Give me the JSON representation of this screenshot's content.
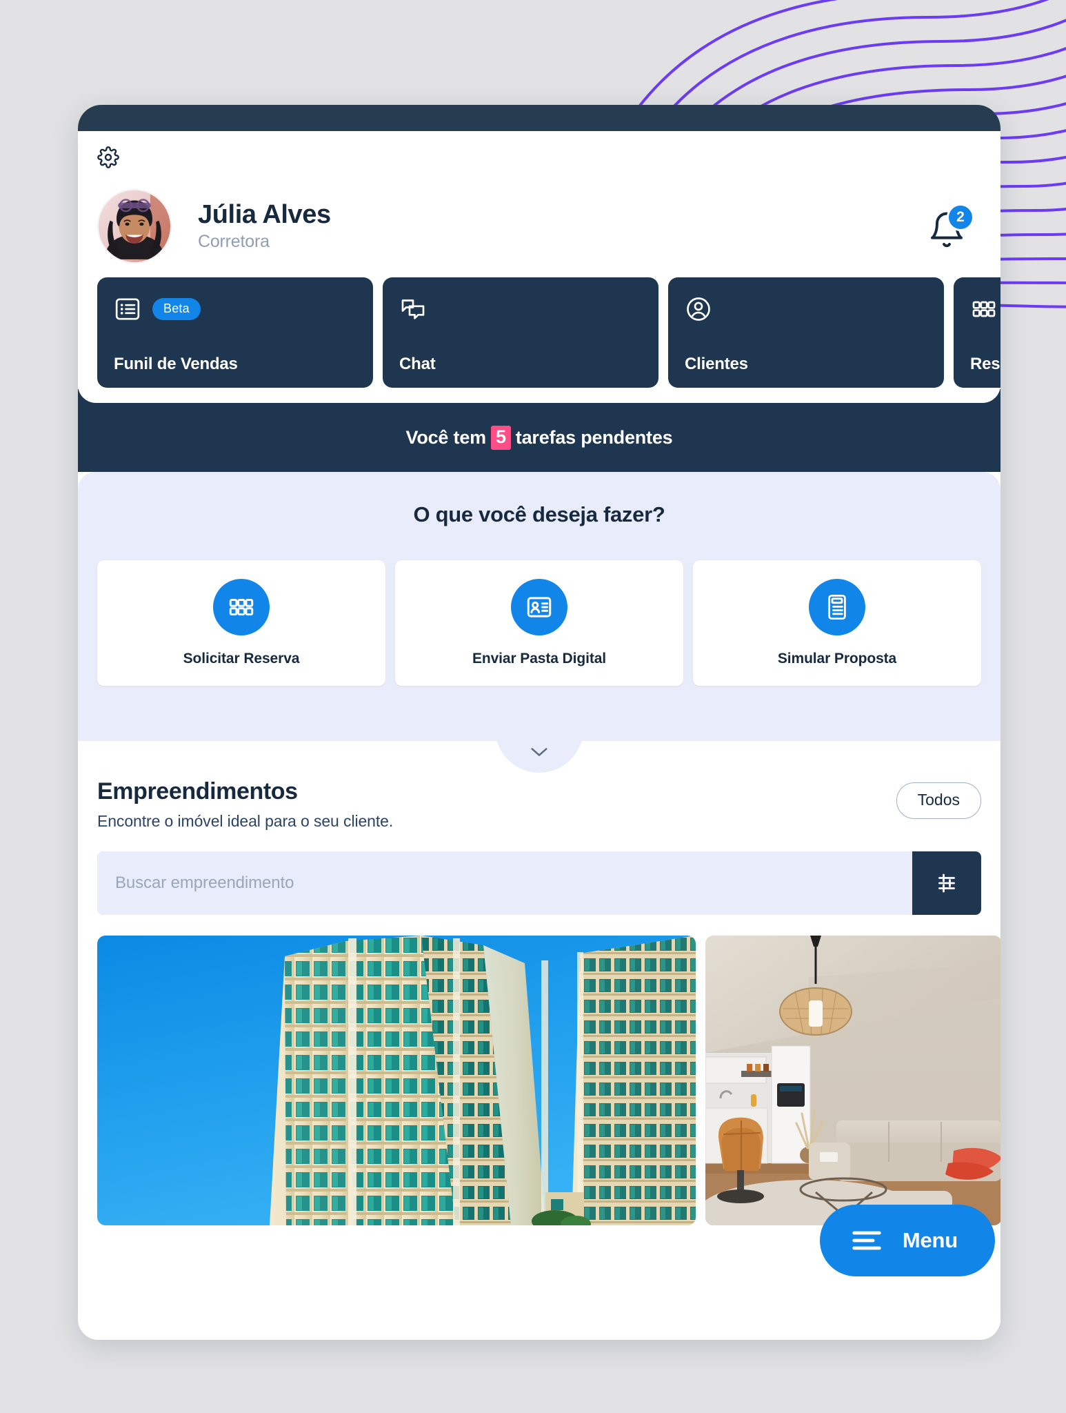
{
  "header": {
    "settings_icon": "gear-icon",
    "profile": {
      "name": "Júlia Alves",
      "role": "Corretora",
      "avatar_icon": "user-photo"
    },
    "notifications": {
      "icon": "bell-icon",
      "count": "2",
      "badge_color": "#1186e8"
    }
  },
  "nav_tiles": [
    {
      "label": "Funil de Vendas",
      "icon": "list-icon",
      "badge": "Beta"
    },
    {
      "label": "Chat",
      "icon": "chat-bubbles-icon",
      "badge": ""
    },
    {
      "label": "Clientes",
      "icon": "user-circle-icon",
      "badge": ""
    },
    {
      "label": "Reserv",
      "icon": "grid-icon",
      "badge": ""
    }
  ],
  "task_banner": {
    "prefix": "Você  tem",
    "count": "5",
    "suffix": "tarefas pendentes",
    "highlight_color": "#ff4d87",
    "background_color": "#1e3650"
  },
  "actions": {
    "title": "O que você deseja fazer?",
    "cards": [
      {
        "label": "Solicitar Reserva",
        "icon": "grid-icon"
      },
      {
        "label": "Enviar Pasta Digital",
        "icon": "id-card-icon"
      },
      {
        "label": "Simular Proposta",
        "icon": "calculator-icon"
      }
    ],
    "collapse_icon": "chevron-down-icon"
  },
  "listings": {
    "title": "Empreendimentos",
    "subtitle": "Encontre o imóvel ideal para o seu cliente.",
    "filter_pill": "Todos",
    "search_placeholder": "Buscar empreendimento",
    "search_value": "",
    "filter_button_icon": "sliders-icon",
    "properties": [
      {
        "image": "highrise-apartment-towers-blue-sky"
      },
      {
        "image": "modern-living-room-kitchen-interior"
      }
    ]
  },
  "menu_fab": {
    "label": "Menu",
    "icon": "hamburger-icon",
    "color": "#1186e8"
  },
  "theme": {
    "dark_navy": "#1e3650",
    "status_strip": "#273c51",
    "accent_blue": "#1186e8",
    "lavender": "#e9ecfa",
    "page_background": "#e2e2e4",
    "wave_purple": "#6c3bf4"
  }
}
